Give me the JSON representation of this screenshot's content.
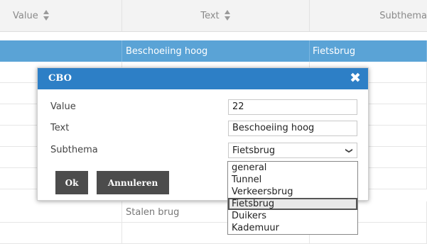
{
  "grid": {
    "columns": [
      {
        "label": "Value"
      },
      {
        "label": "Text"
      },
      {
        "label": "Subthema"
      }
    ],
    "selected_row": {
      "text": "Beschoeiing hoog",
      "subthema": "Fietsbrug"
    },
    "visible_rows_text": [
      "Stalen brug"
    ]
  },
  "dialog": {
    "title": "CBO",
    "close_glyph": "✖",
    "value_label": "Value",
    "value": "22",
    "text_label": "Text",
    "text_value": "Beschoeiing hoog",
    "subthema_label": "Subthema",
    "subthema_selected": "Fietsbrug",
    "ok_label": "Ok",
    "cancel_label": "Annuleren"
  },
  "dropdown": {
    "options": [
      "general",
      "Tunnel",
      "Verkeersbrug",
      "Fietsbrug",
      "Duikers",
      "Kademuur"
    ],
    "highlighted_index": 3
  },
  "colors": {
    "selected_row": "#5aa3d6",
    "titlebar": "#2d7fc6",
    "button": "#4c4c4c"
  }
}
